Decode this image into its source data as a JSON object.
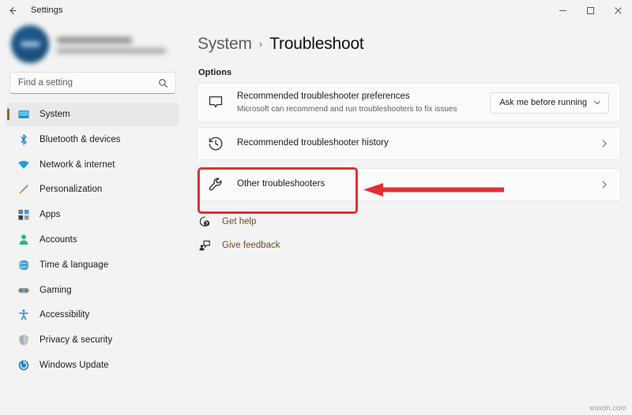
{
  "window": {
    "title": "Settings",
    "back_icon": "back-arrow-icon",
    "controls": {
      "minimize": "minimize-icon",
      "maximize": "maximize-icon",
      "close": "close-icon"
    }
  },
  "sidebar": {
    "profile": {
      "name_redacted": "",
      "email_redacted": ""
    },
    "search": {
      "placeholder": "Find a setting",
      "value": "",
      "icon": "search-icon"
    },
    "items": [
      {
        "label": "System",
        "icon": "monitor-icon",
        "selected": true
      },
      {
        "label": "Bluetooth & devices",
        "icon": "bluetooth-icon",
        "selected": false
      },
      {
        "label": "Network & internet",
        "icon": "wifi-icon",
        "selected": false
      },
      {
        "label": "Personalization",
        "icon": "paintbrush-icon",
        "selected": false
      },
      {
        "label": "Apps",
        "icon": "apps-grid-icon",
        "selected": false
      },
      {
        "label": "Accounts",
        "icon": "person-icon",
        "selected": false
      },
      {
        "label": "Time & language",
        "icon": "globe-clock-icon",
        "selected": false
      },
      {
        "label": "Gaming",
        "icon": "gamepad-icon",
        "selected": false
      },
      {
        "label": "Accessibility",
        "icon": "accessibility-person-icon",
        "selected": false
      },
      {
        "label": "Privacy & security",
        "icon": "shield-icon",
        "selected": false
      },
      {
        "label": "Windows Update",
        "icon": "update-refresh-icon",
        "selected": false
      }
    ]
  },
  "main": {
    "breadcrumb": {
      "parent": "System",
      "separator": "›",
      "current": "Troubleshoot"
    },
    "section_label": "Options",
    "cards": [
      {
        "icon": "speech-bubble-icon",
        "title": "Recommended troubleshooter preferences",
        "subtitle": "Microsoft can recommend and run troubleshooters to fix issues",
        "control": "dropdown",
        "dropdown_value": "Ask me before running",
        "dropdown_chevron": "chevron-down-icon"
      },
      {
        "icon": "history-clock-icon",
        "title": "Recommended troubleshooter history",
        "subtitle": "",
        "control": "chevron",
        "chevron": "chevron-right-icon"
      },
      {
        "icon": "wrench-icon",
        "title": "Other troubleshooters",
        "subtitle": "",
        "control": "chevron",
        "chevron": "chevron-right-icon"
      }
    ],
    "links": [
      {
        "label": "Get help",
        "icon": "get-help-icon"
      },
      {
        "label": "Give feedback",
        "icon": "give-feedback-icon"
      }
    ]
  },
  "annotation": {
    "highlight_color": "#e03131",
    "target_label": "Other troubleshooters"
  },
  "watermark": "wsxdn.com"
}
